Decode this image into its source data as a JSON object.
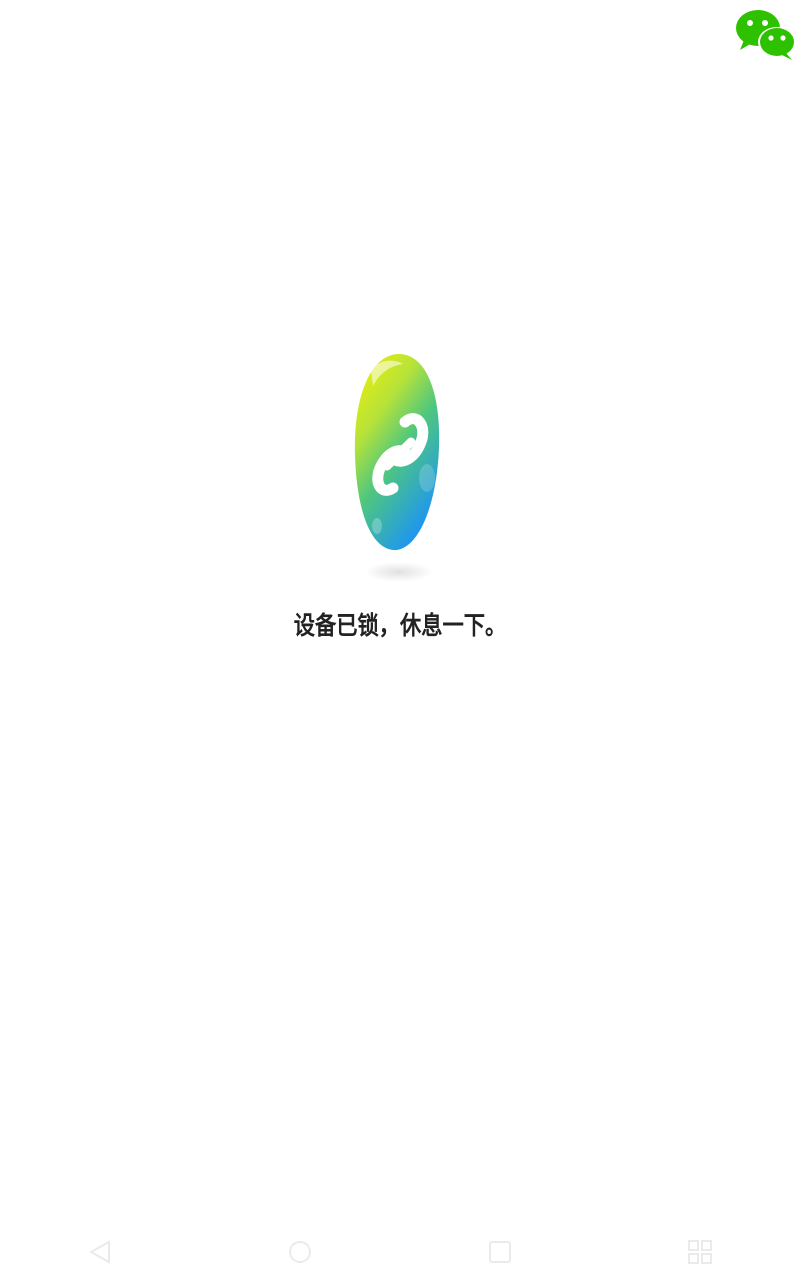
{
  "colors": {
    "background": "#ffffff",
    "wechat_green": "#2DC100",
    "logo_yellow": "#F2EE00",
    "logo_green": "#5CC96A",
    "logo_blue": "#1E96F0",
    "text": "#222222"
  },
  "header": {
    "wechat_icon": "wechat-icon"
  },
  "lock_screen": {
    "logo_icon": "chain-link-icon",
    "message": "设备已锁，休息一下。"
  },
  "nav_bar": {
    "back_icon": "back-triangle-icon",
    "home_icon": "home-circle-icon",
    "recents_icon": "recents-square-icon",
    "menu_icon": "menu-grid-icon"
  }
}
